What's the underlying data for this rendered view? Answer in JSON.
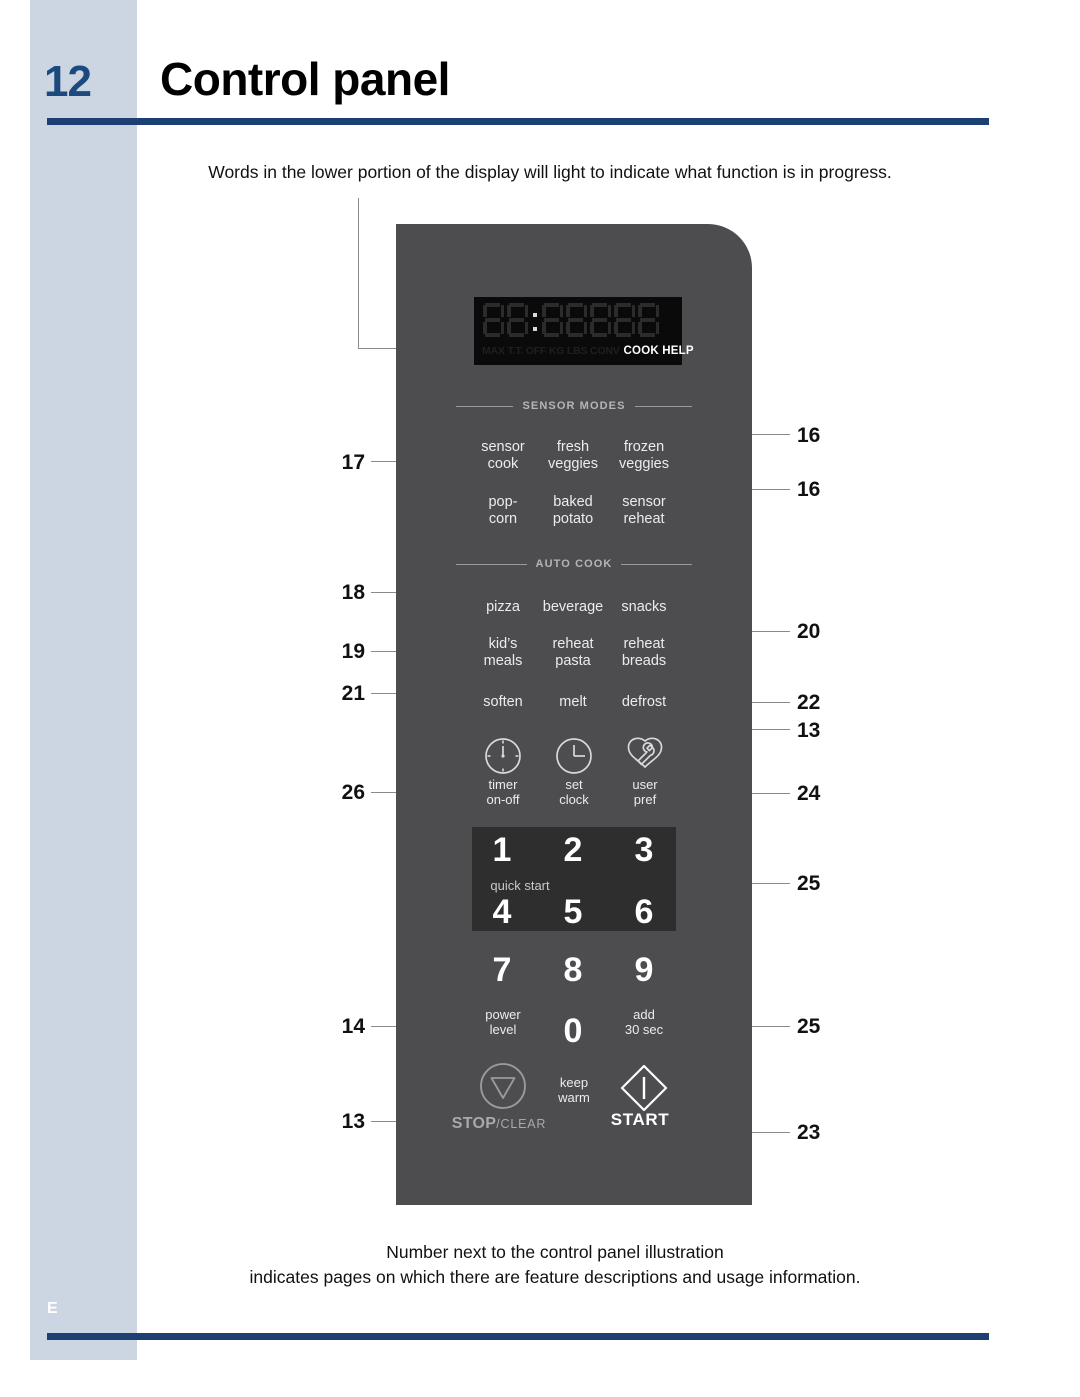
{
  "page": {
    "number": "12",
    "title": "Control panel",
    "footer_letter": "E",
    "caption_top": "Words in the lower portion of the display will light to indicate what function is in progress.",
    "caption_bottom_line1": "Number next to the control panel illustration",
    "caption_bottom_line2": "indicates pages on which there are feature descriptions and usage information.",
    "colors": {
      "accent_blue": "#1c3f74",
      "page_number_blue": "#1c4a7e",
      "band_blue": "#ccd6e2",
      "panel_dark": "#4d4d4f",
      "display_black": "#0a0a0a",
      "quickstart_plate": "#2e2e2e"
    }
  },
  "panel": {
    "display": {
      "digits": "88:88888",
      "indicator_words_dim": "MAX T.T. OFF KG LBS CONV",
      "indicator_words_lit": "COOK HELP"
    },
    "sections": [
      {
        "id": "sensor-modes",
        "label": "SENSOR MODES"
      },
      {
        "id": "auto-cook",
        "label": "AUTO COOK"
      }
    ],
    "sensor_keys": [
      {
        "line1": "sensor",
        "line2": "cook"
      },
      {
        "line1": "fresh",
        "line2": "veggies"
      },
      {
        "line1": "frozen",
        "line2": "veggies"
      },
      {
        "line1": "pop-",
        "line2": "corn"
      },
      {
        "line1": "baked",
        "line2": "potato"
      },
      {
        "line1": "sensor",
        "line2": "reheat"
      }
    ],
    "auto_cook_keys": [
      {
        "line1": "pizza",
        "line2": ""
      },
      {
        "line1": "beverage",
        "line2": ""
      },
      {
        "line1": "snacks",
        "line2": ""
      },
      {
        "line1": "kid’s",
        "line2": "meals"
      },
      {
        "line1": "reheat",
        "line2": "pasta"
      },
      {
        "line1": "reheat",
        "line2": "breads"
      },
      {
        "line1": "soften",
        "line2": ""
      },
      {
        "line1": "melt",
        "line2": ""
      },
      {
        "line1": "defrost",
        "line2": ""
      }
    ],
    "icon_keys": [
      {
        "icon": "timer-icon",
        "line1": "timer",
        "line2": "on-off"
      },
      {
        "icon": "clock-icon",
        "line1": "set",
        "line2": "clock"
      },
      {
        "icon": "wrench-icon",
        "line1": "user",
        "line2": "pref"
      }
    ],
    "keypad": {
      "digits": [
        "1",
        "2",
        "3",
        "4",
        "5",
        "6",
        "7",
        "8",
        "9",
        "0"
      ],
      "quick_start_label": "quick start"
    },
    "bottom_keys": {
      "power_level_line1": "power",
      "power_level_line2": "level",
      "add_30_line1": "add",
      "add_30_line2": "30 sec",
      "keep_warm_line1": "keep",
      "keep_warm_line2": "warm",
      "stop_bold": "STOP",
      "stop_slash": "/",
      "stop_light": "CLEAR",
      "start_label": "START"
    }
  },
  "callouts": {
    "left": [
      {
        "number": "17"
      },
      {
        "number": "18"
      },
      {
        "number": "19"
      },
      {
        "number": "21"
      },
      {
        "number": "26"
      },
      {
        "number": "14"
      },
      {
        "number": "13"
      }
    ],
    "right": [
      {
        "number": "16"
      },
      {
        "number": "16"
      },
      {
        "number": "20"
      },
      {
        "number": "22"
      },
      {
        "number": "13"
      },
      {
        "number": "24"
      },
      {
        "number": "25"
      },
      {
        "number": "25"
      },
      {
        "number": "23"
      }
    ]
  }
}
